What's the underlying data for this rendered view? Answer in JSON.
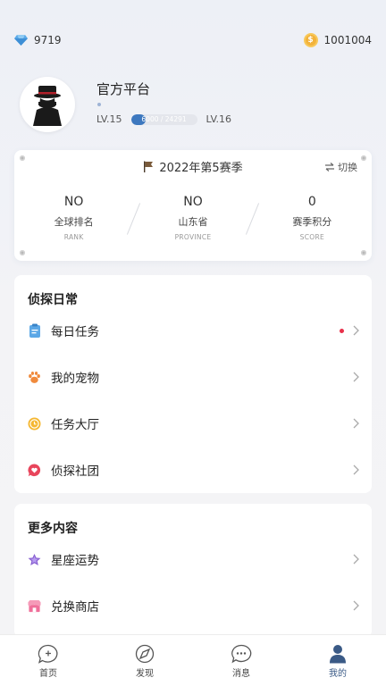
{
  "header": {
    "diamonds": "9719",
    "coins": "1001004"
  },
  "profile": {
    "nickname": "官方平台",
    "level_current": "LV.15",
    "level_next": "LV.16",
    "xp_text": "6000 / 24291",
    "xp_progress": 0.22
  },
  "season": {
    "title": "2022年第5赛季",
    "switch_label": "切换",
    "stats": [
      {
        "value": "NO",
        "label": "全球排名",
        "sub": "RANK"
      },
      {
        "value": "NO",
        "label": "山东省",
        "sub": "PROVINCE"
      },
      {
        "value": "0",
        "label": "赛季积分",
        "sub": "SCORE"
      }
    ]
  },
  "daily": {
    "title": "侦探日常",
    "items": [
      {
        "label": "每日任务",
        "icon": "clipboard-icon",
        "badge": true
      },
      {
        "label": "我的宠物",
        "icon": "paw-icon",
        "badge": false
      },
      {
        "label": "任务大厅",
        "icon": "coin-clock-icon",
        "badge": false
      },
      {
        "label": "侦探社团",
        "icon": "chat-heart-icon",
        "badge": false
      }
    ]
  },
  "more": {
    "title": "更多内容",
    "items": [
      {
        "label": "星座运势",
        "icon": "star-icon"
      },
      {
        "label": "兑换商店",
        "icon": "shop-icon"
      }
    ]
  },
  "tabbar": {
    "tabs": [
      {
        "label": "首页",
        "icon": "home-chat-icon",
        "active": false
      },
      {
        "label": "发现",
        "icon": "compass-icon",
        "active": false
      },
      {
        "label": "消息",
        "icon": "message-icon",
        "active": false
      },
      {
        "label": "我的",
        "icon": "profile-icon",
        "active": true
      }
    ]
  },
  "colors": {
    "accent": "#3d78bf",
    "badge": "#e8304a",
    "coin": "#f2b23b",
    "active_tab": "#3a5a86"
  }
}
